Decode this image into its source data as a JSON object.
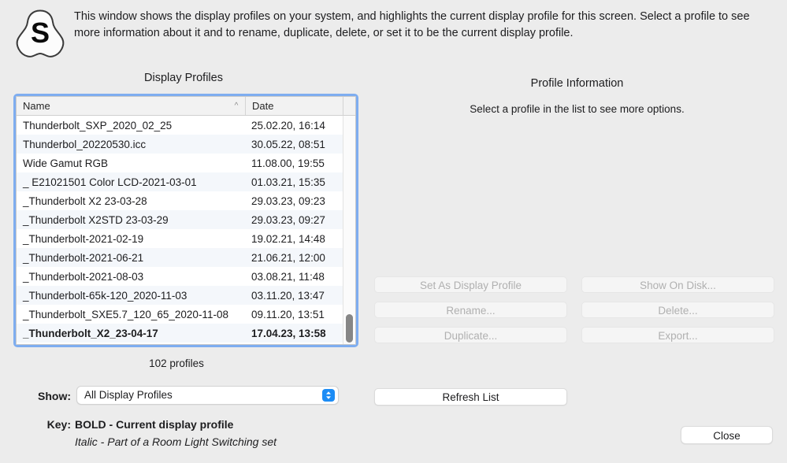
{
  "window": {
    "icon_letter": "S",
    "description": "This window shows the display profiles on your system, and highlights the current display profile for this screen. Select a profile to see more information about it and to rename, duplicate, delete, or set it to be the current display profile."
  },
  "left_panel": {
    "title": "Display Profiles",
    "count_text": "102 profiles",
    "table": {
      "columns": [
        "Name",
        "Date"
      ],
      "sort_column": "Name",
      "sort_direction": "ascending",
      "sort_icon": "chevron-up-icon",
      "rows": [
        {
          "name": "Thunderbolt_SXP_2020_02_25",
          "date": "25.02.20, 16:14",
          "current": false
        },
        {
          "name": "Thunderbol_20220530.icc",
          "date": "30.05.22, 08:51",
          "current": false
        },
        {
          "name": "Wide Gamut RGB",
          "date": "11.08.00, 19:55",
          "current": false
        },
        {
          "name": "_ E21021501 Color LCD-2021-03-01",
          "date": "01.03.21, 15:35",
          "current": false
        },
        {
          "name": "_Thunderbolt X2 23-03-28",
          "date": "29.03.23, 09:23",
          "current": false
        },
        {
          "name": "_Thunderbolt X2STD 23-03-29",
          "date": "29.03.23, 09:27",
          "current": false
        },
        {
          "name": "_Thunderbolt-2021-02-19",
          "date": "19.02.21, 14:48",
          "current": false
        },
        {
          "name": "_Thunderbolt-2021-06-21",
          "date": "21.06.21, 12:00",
          "current": false
        },
        {
          "name": "_Thunderbolt-2021-08-03",
          "date": "03.08.21, 11:48",
          "current": false
        },
        {
          "name": "_Thunderbolt-65k-120_2020-11-03",
          "date": "03.11.20, 13:47",
          "current": false
        },
        {
          "name": "_Thunderbolt_SXE5.7_120_65_2020-11-08",
          "date": "09.11.20, 13:51",
          "current": false
        },
        {
          "name": "_Thunderbolt_X2_23-04-17",
          "date": "17.04.23, 13:58",
          "current": true
        }
      ]
    }
  },
  "right_panel": {
    "title": "Profile Information",
    "empty_message": "Select a profile in the list to see more options.",
    "buttons": [
      {
        "label": "Set As Display Profile",
        "enabled": false
      },
      {
        "label": "Show On Disk...",
        "enabled": false
      },
      {
        "label": "Rename...",
        "enabled": false
      },
      {
        "label": "Delete...",
        "enabled": false
      },
      {
        "label": "Duplicate...",
        "enabled": false
      },
      {
        "label": "Export...",
        "enabled": false
      }
    ],
    "refresh_label": "Refresh List"
  },
  "footer": {
    "show_label": "Show:",
    "show_value": "All Display Profiles",
    "show_options": [
      "All Display Profiles"
    ],
    "key_label": "Key:",
    "key_bold_text": "BOLD - Current display profile",
    "key_italic_text": "Italic - Part of a Room Light Switching set",
    "close_label": "Close"
  },
  "colors": {
    "window_background": "#ececec",
    "focus_ring": "#7eadf0",
    "popup_accent": "#1c8cf5",
    "row_alt": "#f4f7fb",
    "disabled_text": "#b0b0b0"
  }
}
